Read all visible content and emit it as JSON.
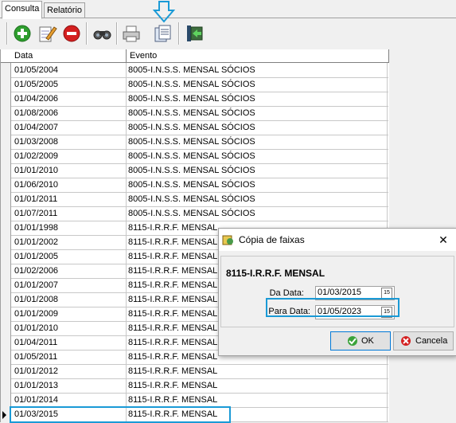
{
  "tabs": [
    {
      "label": "Consulta",
      "active": true
    },
    {
      "label": "Relatório",
      "active": false
    }
  ],
  "toolbar": {
    "buttons": [
      "add-icon",
      "edit-icon",
      "delete-icon",
      "search-binoculars-icon",
      "print-icon",
      "copy-document-icon",
      "exit-icon"
    ]
  },
  "grid": {
    "columns": [
      "Data",
      "Evento"
    ],
    "rows": [
      [
        "01/05/2004",
        "8005-I.N.S.S. MENSAL SÓCIOS"
      ],
      [
        "01/05/2005",
        "8005-I.N.S.S. MENSAL SÓCIOS"
      ],
      [
        "01/04/2006",
        "8005-I.N.S.S. MENSAL SÓCIOS"
      ],
      [
        "01/08/2006",
        "8005-I.N.S.S. MENSAL SÓCIOS"
      ],
      [
        "01/04/2007",
        "8005-I.N.S.S. MENSAL SÓCIOS"
      ],
      [
        "01/03/2008",
        "8005-I.N.S.S. MENSAL SÓCIOS"
      ],
      [
        "01/02/2009",
        "8005-I.N.S.S. MENSAL SÓCIOS"
      ],
      [
        "01/01/2010",
        "8005-I.N.S.S. MENSAL SÓCIOS"
      ],
      [
        "01/06/2010",
        "8005-I.N.S.S. MENSAL SÓCIOS"
      ],
      [
        "01/01/2011",
        "8005-I.N.S.S. MENSAL SÓCIOS"
      ],
      [
        "01/07/2011",
        "8005-I.N.S.S. MENSAL SÓCIOS"
      ],
      [
        "01/01/1998",
        "8115-I.R.R.F. MENSAL"
      ],
      [
        "01/01/2002",
        "8115-I.R.R.F. MENSAL"
      ],
      [
        "01/01/2005",
        "8115-I.R.R.F. MENSAL"
      ],
      [
        "01/02/2006",
        "8115-I.R.R.F. MENSAL"
      ],
      [
        "01/01/2007",
        "8115-I.R.R.F. MENSAL"
      ],
      [
        "01/01/2008",
        "8115-I.R.R.F. MENSAL"
      ],
      [
        "01/01/2009",
        "8115-I.R.R.F. MENSAL"
      ],
      [
        "01/01/2010",
        "8115-I.R.R.F. MENSAL"
      ],
      [
        "01/04/2011",
        "8115-I.R.R.F. MENSAL"
      ],
      [
        "01/05/2011",
        "8115-I.R.R.F. MENSAL"
      ],
      [
        "01/01/2012",
        "8115-I.R.R.F. MENSAL"
      ],
      [
        "01/01/2013",
        "8115-I.R.R.F. MENSAL"
      ],
      [
        "01/01/2014",
        "8115-I.R.R.F. MENSAL"
      ],
      [
        "01/03/2015",
        "8115-I.R.R.F. MENSAL"
      ]
    ]
  },
  "dialog": {
    "title": "Cópia de faixas",
    "heading": "8115-I.R.R.F. MENSAL",
    "da_data_label": "Da Data:",
    "da_data_value": "01/03/2015",
    "para_data_label": "Para Data:",
    "para_data_value": "01/05/2023",
    "ok_label": "OK",
    "cancel_label": "Cancela",
    "calendar_glyph": "15"
  },
  "colors": {
    "highlight": "#1a9ad6",
    "ok_border": "#0078d7"
  }
}
